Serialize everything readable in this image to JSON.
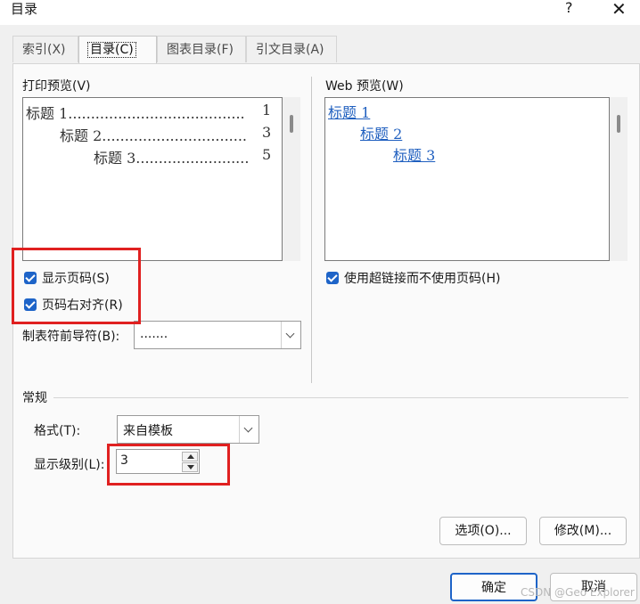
{
  "window": {
    "title": "目录",
    "help_glyph": "?",
    "close_glyph": "✕"
  },
  "tabs": [
    {
      "label": "索引(X)",
      "active": false
    },
    {
      "label": "目录(C)",
      "active": true
    },
    {
      "label": "图表目录(F)",
      "active": false
    },
    {
      "label": "引文目录(A)",
      "active": false
    }
  ],
  "print_preview": {
    "label": "打印预览(V)",
    "lines": [
      {
        "text": "标题 1......................................."
      },
      {
        "num": "1"
      },
      {
        "text": "标题 2................................"
      },
      {
        "num": "3"
      },
      {
        "text": "标题 3........................."
      },
      {
        "num": "5"
      }
    ],
    "show_page_numbers": "显示页码(S)",
    "right_align": "页码右对齐(R)",
    "tab_leader_label": "制表符前导符(B):",
    "tab_leader_value": "......."
  },
  "web_preview": {
    "label": "Web 预览(W)",
    "links": [
      "标题 1",
      "标题 2",
      "标题 3"
    ],
    "use_hyperlinks": "使用超链接而不使用页码(H)"
  },
  "general": {
    "section_label": "常规",
    "format_label": "格式(T):",
    "format_value": "来自模板",
    "levels_label": "显示级别(L):",
    "levels_value": "3"
  },
  "buttons": {
    "options": "选项(O)...",
    "modify": "修改(M)...",
    "ok": "确定",
    "cancel": "取消"
  },
  "watermark": "CSDN @Geo Explorer",
  "colors": {
    "highlight": "#e02020",
    "checkbox": "#1e64c8",
    "link": "#1f5fbf"
  }
}
